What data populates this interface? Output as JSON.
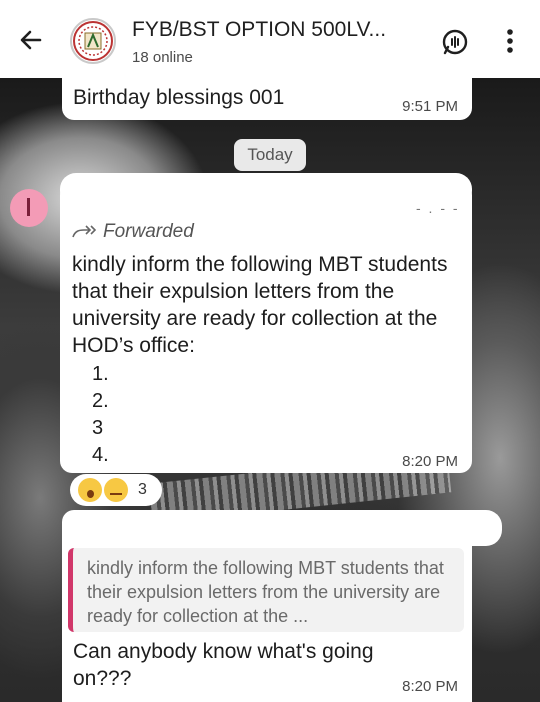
{
  "header": {
    "title": "FYB/BST OPTION 500LV...",
    "subtitle": "18 online"
  },
  "messages": [
    {
      "text": "Birthday blessings 001",
      "time": "9:51 PM"
    }
  ],
  "date_divider": "Today",
  "forwarded_message": {
    "sender_initial": "I",
    "forwarded_label": "Forwarded",
    "text": "kindly inform the following MBT students that their expulsion letters from the university are ready for collection at the HOD’s office:",
    "list": [
      "1.",
      "2.",
      "3",
      "4."
    ],
    "time": "8:20 PM",
    "reaction_count": "3"
  },
  "reply_message": {
    "quoted_text": "kindly inform the following MBT students that their expulsion letters from the university are ready for collection at the ...",
    "text": "Can anybody know what's going on???",
    "time": "8:20 PM"
  },
  "colors": {
    "header_bg": "#ffffff",
    "bubble_bg": "#ffffff",
    "quote_bar": "#d1376a",
    "sender_avatar": "#f39bb6"
  },
  "icons": [
    "arrow-left-icon",
    "group-avatar",
    "voice-call-icon",
    "more-vertical-icon",
    "forward-icon"
  ]
}
